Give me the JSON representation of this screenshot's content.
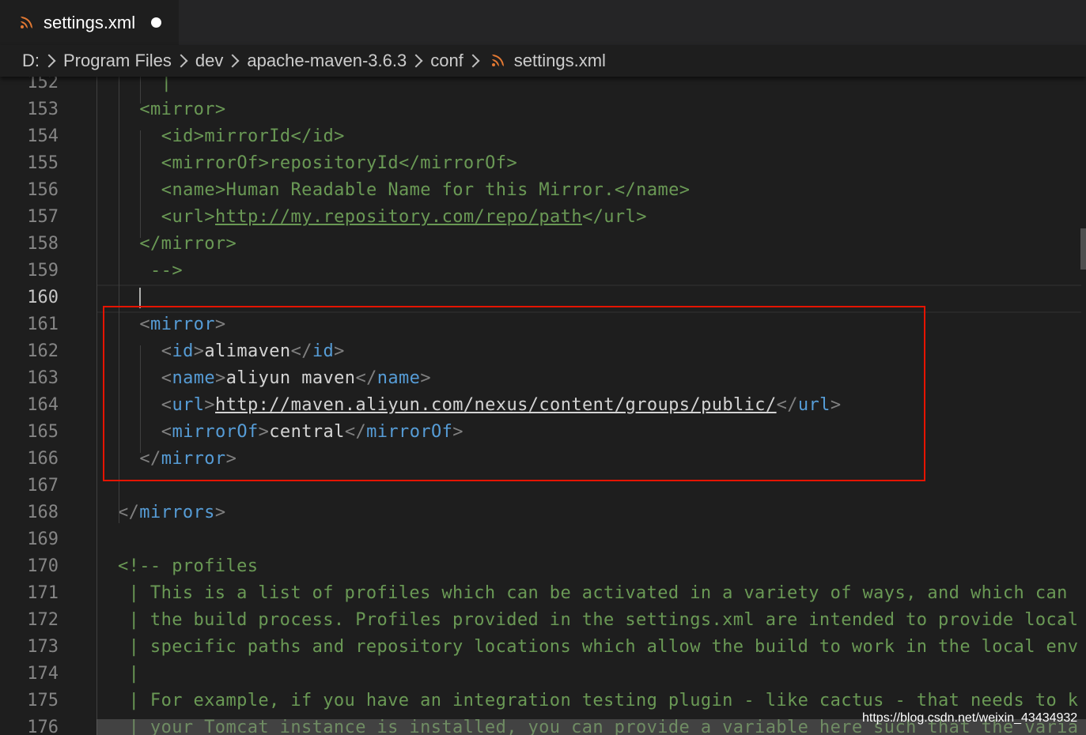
{
  "tab": {
    "filename": "settings.xml",
    "icon": "rss-file-icon",
    "modified": true
  },
  "breadcrumb": [
    "D:",
    "Program Files",
    "dev",
    "apache-maven-3.6.3",
    "conf",
    "settings.xml"
  ],
  "editor": {
    "active_line": "160",
    "lines": [
      {
        "n": "152",
        "indent": 2,
        "parts": [
          [
            "com",
            "|"
          ]
        ]
      },
      {
        "n": "153",
        "indent": 1,
        "parts": [
          [
            "com",
            "<mirror>"
          ]
        ]
      },
      {
        "n": "154",
        "indent": 2,
        "parts": [
          [
            "com",
            "<id>mirrorId</id>"
          ]
        ]
      },
      {
        "n": "155",
        "indent": 2,
        "parts": [
          [
            "com",
            "<mirrorOf>repositoryId</mirrorOf>"
          ]
        ]
      },
      {
        "n": "156",
        "indent": 2,
        "parts": [
          [
            "com",
            "<name>Human Readable Name for this Mirror.</name>"
          ]
        ]
      },
      {
        "n": "157",
        "indent": 2,
        "parts": [
          [
            "com",
            "<url>"
          ],
          [
            "com-u",
            "http://my.repository.com/repo/path"
          ],
          [
            "com",
            "</url>"
          ]
        ]
      },
      {
        "n": "158",
        "indent": 1,
        "parts": [
          [
            "com",
            "</mirror>"
          ]
        ]
      },
      {
        "n": "159",
        "indent": 1,
        "parts": [
          [
            "com",
            " -->"
          ]
        ]
      },
      {
        "n": "160",
        "indent": 0,
        "parts": []
      },
      {
        "n": "161",
        "indent": 1,
        "parts": [
          [
            "br",
            "<"
          ],
          [
            "tag",
            "mirror"
          ],
          [
            "br",
            ">"
          ]
        ]
      },
      {
        "n": "162",
        "indent": 2,
        "parts": [
          [
            "br",
            "<"
          ],
          [
            "tag",
            "id"
          ],
          [
            "br",
            ">"
          ],
          [
            "txt",
            "alimaven"
          ],
          [
            "br",
            "</"
          ],
          [
            "tag",
            "id"
          ],
          [
            "br",
            ">"
          ]
        ]
      },
      {
        "n": "163",
        "indent": 2,
        "parts": [
          [
            "br",
            "<"
          ],
          [
            "tag",
            "name"
          ],
          [
            "br",
            ">"
          ],
          [
            "txt",
            "aliyun maven"
          ],
          [
            "br",
            "</"
          ],
          [
            "tag",
            "name"
          ],
          [
            "br",
            ">"
          ]
        ]
      },
      {
        "n": "164",
        "indent": 2,
        "parts": [
          [
            "br",
            "<"
          ],
          [
            "tag",
            "url"
          ],
          [
            "br",
            ">"
          ],
          [
            "url",
            "http://maven.aliyun.com/nexus/content/groups/public/"
          ],
          [
            "br",
            "</"
          ],
          [
            "tag",
            "url"
          ],
          [
            "br",
            ">"
          ]
        ]
      },
      {
        "n": "165",
        "indent": 2,
        "parts": [
          [
            "br",
            "<"
          ],
          [
            "tag",
            "mirrorOf"
          ],
          [
            "br",
            ">"
          ],
          [
            "txt",
            "central"
          ],
          [
            "br",
            "</"
          ],
          [
            "tag",
            "mirrorOf"
          ],
          [
            "br",
            ">"
          ]
        ]
      },
      {
        "n": "166",
        "indent": 1,
        "parts": [
          [
            "br",
            "</"
          ],
          [
            "tag",
            "mirror"
          ],
          [
            "br",
            ">"
          ]
        ]
      },
      {
        "n": "167",
        "indent": 0,
        "parts": []
      },
      {
        "n": "168",
        "indent": 0,
        "parts": [
          [
            "br",
            "</"
          ],
          [
            "tag",
            "mirrors"
          ],
          [
            "br",
            ">"
          ]
        ]
      },
      {
        "n": "169",
        "indent": 0,
        "parts": []
      },
      {
        "n": "170",
        "indent": 0,
        "parts": [
          [
            "com",
            "<!-- profiles"
          ]
        ]
      },
      {
        "n": "171",
        "indent": 0,
        "parts": [
          [
            "com",
            " | This is a list of profiles which can be activated in a variety of ways, and which can"
          ]
        ]
      },
      {
        "n": "172",
        "indent": 0,
        "parts": [
          [
            "com",
            " | the build process. Profiles provided in the settings.xml are intended to provide local"
          ]
        ]
      },
      {
        "n": "173",
        "indent": 0,
        "parts": [
          [
            "com",
            " | specific paths and repository locations which allow the build to work in the local env"
          ]
        ]
      },
      {
        "n": "174",
        "indent": 0,
        "parts": [
          [
            "com",
            " |"
          ]
        ]
      },
      {
        "n": "175",
        "indent": 0,
        "parts": [
          [
            "com",
            " | For example, if you have an integration testing plugin - like cactus - that needs to k"
          ]
        ]
      },
      {
        "n": "176",
        "indent": 0,
        "parts": [
          [
            "com",
            " | your Tomcat instance is installed, you can provide a variable here such that the varia"
          ]
        ]
      }
    ]
  },
  "watermark": "https://blog.csdn.net/weixin_43434932",
  "colors": {
    "tag": "#569cd6",
    "bracket": "#808080",
    "comment": "#6a9955",
    "text": "#d4d4d4",
    "highlight_box": "#e51400",
    "background": "#1e1e1e"
  }
}
